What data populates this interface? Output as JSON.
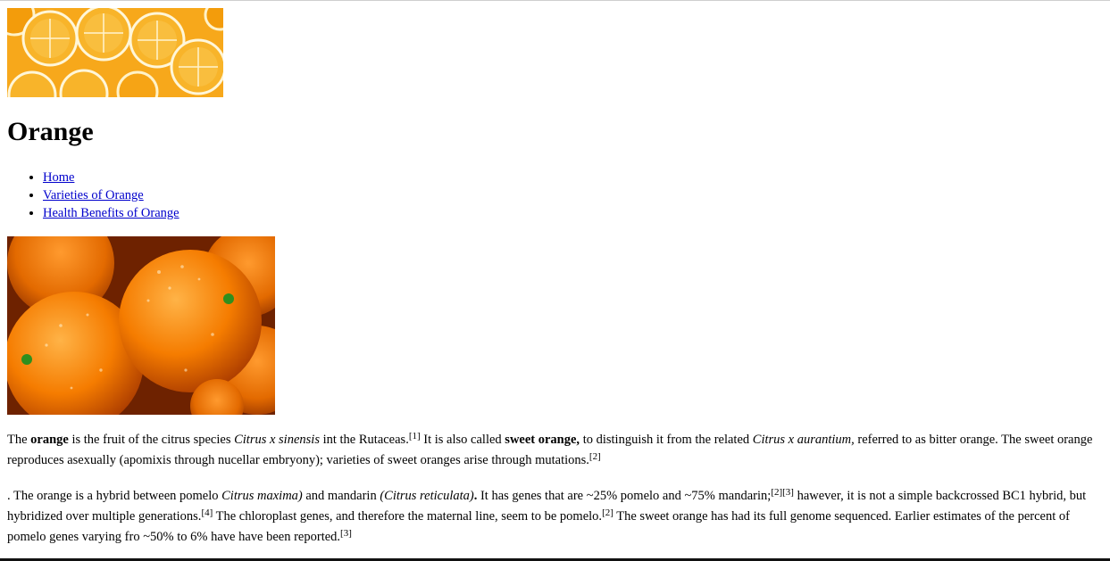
{
  "page": {
    "title": "Orange",
    "nav": [
      {
        "label": "Home"
      },
      {
        "label": "Varieties of Orange"
      },
      {
        "label": "Health Benefits of Orange"
      }
    ]
  },
  "images": {
    "banner_icon": "orange-slices-banner",
    "photo_icon": "whole-oranges-photo"
  },
  "colors": {
    "link": "#0000cc",
    "orange": "#f59a0d",
    "deep_orange": "#e86a00"
  },
  "paragraph1": {
    "s1": "The ",
    "b1": "orange",
    "s2": " is the fruit of the citrus species ",
    "i1": "Citrus x sinensis",
    "s3": " int the Rutaceas.",
    "r1": "[1]",
    "s4": " It is also called ",
    "b2": "sweet orange,",
    "s5": " to distinguish it from the related ",
    "i2": "Citrus x aurantium,",
    "s6": " referred to as bitter orange. The sweet orange reproduces asexually (apomixis through nucellar embryony); varieties of sweet oranges arise through mutations.",
    "r2": "[2]"
  },
  "paragraph2": {
    "s1": ". The orange is a hybrid between pomelo ",
    "i1": "Citrus maxima)",
    "s2": " and mandarin ",
    "i2": "(Citrus reticulata)",
    "b1": ".",
    "s3": " It has genes that are ~25% pomelo and ~75% mandarin;",
    "r1": "[2]",
    "r2": "[3]",
    "s4": " hawever, it is not a simple backcrossed BC1 hybrid, but hybridized over multiple generations.",
    "r3": "[4]",
    "s5": " The chloroplast genes, and therefore the maternal line, seem to be pomelo.",
    "r4": "[2]",
    "s6": " The sweet orange has had its full genome sequenced. Earlier estimates of the percent of pomelo genes varying fro ~50% to 6% have have been reported.",
    "r5": "[3]"
  }
}
